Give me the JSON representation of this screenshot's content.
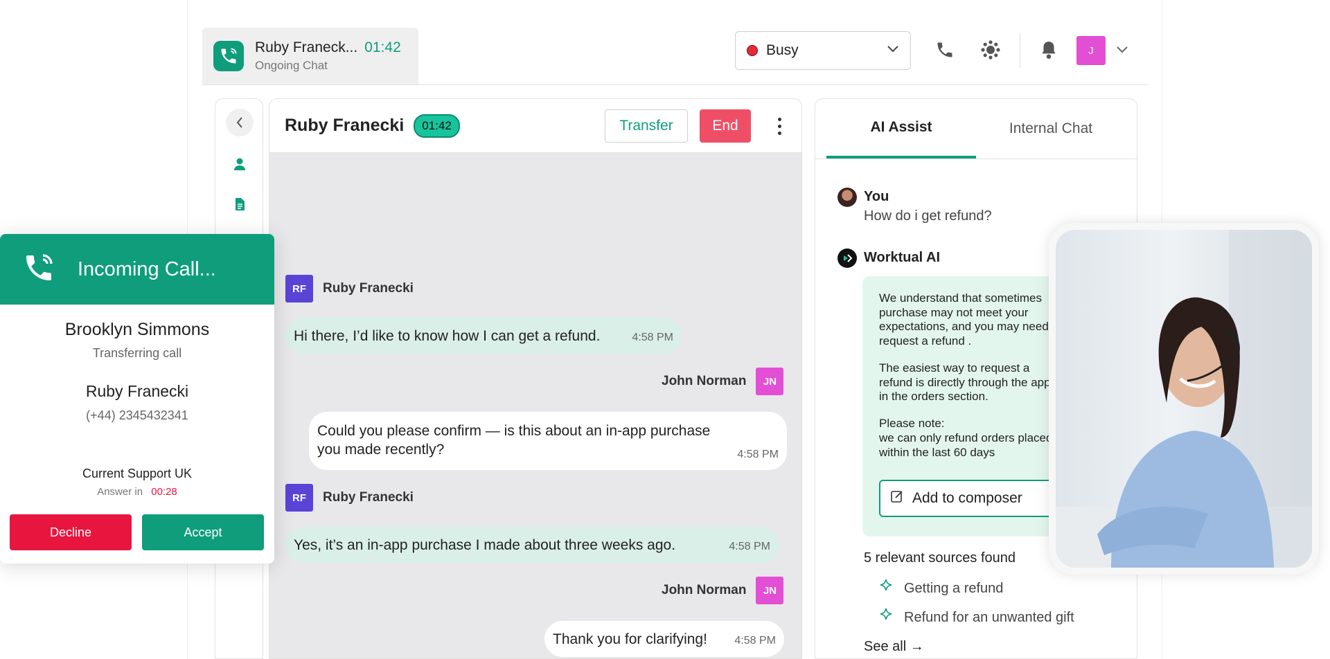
{
  "active_tab": {
    "name": "Ruby Franeck...",
    "timer": "01:42",
    "subtitle": "Ongoing Chat"
  },
  "status": {
    "label": "Busy",
    "color": "#e8293b"
  },
  "user_avatar": "J",
  "chat": {
    "contact_name": "Ruby Franecki",
    "timer": "01:42",
    "transfer_label": "Transfer",
    "end_label": "End",
    "messages": [
      {
        "sender": "Ruby Franecki",
        "initials": "RF",
        "text": "Hi there, I’d like to know how I can get a refund.",
        "time": "4:58 PM"
      },
      {
        "sender": "John Norman",
        "initials": "JN",
        "text": "Could you please confirm — is this about an in-app purchase you made recently?",
        "time": "4:58 PM"
      },
      {
        "sender": "Ruby Franecki",
        "initials": "RF",
        "text": "Yes, it’s an in-app purchase I made about three weeks ago.",
        "time": "4:58 PM"
      },
      {
        "sender": "John Norman",
        "initials": "JN",
        "text": "Thank you for clarifying!",
        "time": "4:58 PM"
      }
    ]
  },
  "ai": {
    "tabs": [
      "AI Assist",
      "Internal Chat"
    ],
    "user_name": "You",
    "user_question": "How do i get refund?",
    "bot_name": "Worktual AI",
    "answer_p1": "We understand that sometimes purchase may not meet your expectations, and you may need request a refund .",
    "answer_p2": "The easiest way to request a refund is directly through the app in the orders section.",
    "answer_p3_a": "Please note:",
    "answer_p3_b": "we can only refund orders placed within the last 60 days",
    "add_composer": "Add to composer",
    "sources_title": "5 relevant sources found",
    "sources": [
      "Getting a refund",
      "Refund for an unwanted gift"
    ],
    "see_all": "See all →"
  },
  "incoming_call": {
    "title": "Incoming Call...",
    "caller": "Brooklyn Simmons",
    "caller_status": "Transferring call",
    "contact": "Ruby Franecki",
    "phone": "(+44) 2345432341",
    "queue": "Current Support UK",
    "answer_in_label": "Answer in",
    "answer_in_time": "00:28",
    "decline": "Decline",
    "accept": "Accept"
  },
  "colors": {
    "brand": "#0f9d7c",
    "danger": "#e8153f",
    "end": "#ef4f66",
    "agent_badge": "#e34fd4",
    "customer_badge": "#5a44d6"
  }
}
